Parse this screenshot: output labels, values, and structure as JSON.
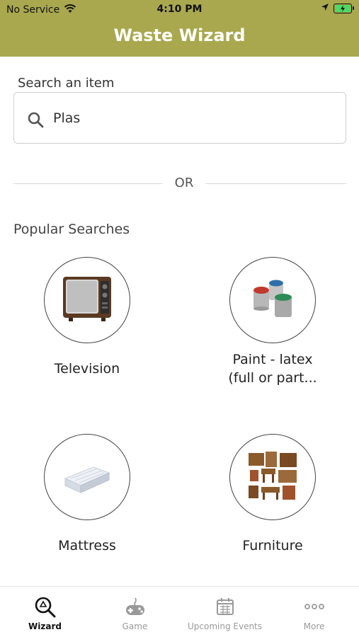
{
  "status_bar": {
    "carrier": "No Service",
    "time": "4:10 PM"
  },
  "header": {
    "title": "Waste Wizard"
  },
  "search": {
    "label": "Search an item",
    "value": "Plas"
  },
  "divider": {
    "text": "OR"
  },
  "popular": {
    "title": "Popular Searches",
    "items": [
      {
        "label": "Television",
        "icon": "television-icon"
      },
      {
        "label": "Paint - latex\n(full or part...",
        "icon": "paint-cans-icon"
      },
      {
        "label": "Mattress",
        "icon": "mattress-icon"
      },
      {
        "label": "Furniture",
        "icon": "furniture-icon"
      }
    ]
  },
  "tabbar": {
    "tabs": [
      {
        "label": "Wizard",
        "active": true,
        "icon": "wizard-search-icon"
      },
      {
        "label": "Game",
        "active": false,
        "icon": "gamepad-icon"
      },
      {
        "label": "Upcoming Events",
        "active": false,
        "icon": "calendar-icon"
      },
      {
        "label": "More",
        "active": false,
        "icon": "more-dots-icon"
      }
    ]
  },
  "colors": {
    "header_bg": "#a9a84e",
    "battery": "#4cd964"
  }
}
